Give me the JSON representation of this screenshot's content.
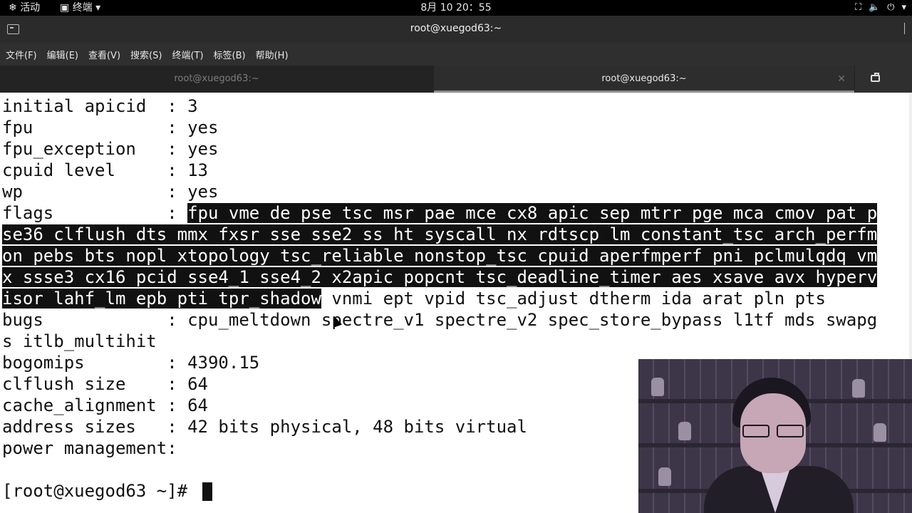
{
  "topbar": {
    "activities": "活动",
    "app_menu": "终端",
    "clock": "8月 10  20：55",
    "tray_icons": [
      "network-icon",
      "volume-icon",
      "power-icon"
    ]
  },
  "window": {
    "title": "root@xuegod63:~"
  },
  "menu": [
    "文件(F)",
    "编辑(E)",
    "查看(V)",
    "搜索(S)",
    "终端(T)",
    "标签(B)",
    "帮助(H)"
  ],
  "tabs": [
    {
      "label": "root@xuegod63:~",
      "active": false
    },
    {
      "label": "root@xuegod63:~",
      "active": true
    }
  ],
  "terminal": {
    "lines": [
      {
        "plain": "initial apicid  : 3",
        "sel": "",
        "after": ""
      },
      {
        "plain": "fpu             : yes",
        "sel": "",
        "after": ""
      },
      {
        "plain": "fpu_exception   : yes",
        "sel": "",
        "after": ""
      },
      {
        "plain": "cpuid level     : 13",
        "sel": "",
        "after": ""
      },
      {
        "plain": "wp              : yes",
        "sel": "",
        "after": ""
      },
      {
        "plain": "flags           : ",
        "sel": "fpu vme de pse tsc msr pae mce cx8 apic sep mtrr pge mca cmov pat p",
        "after": ""
      },
      {
        "plain": "",
        "sel": "se36 clflush dts mmx fxsr sse sse2 ss ht syscall nx rdtscp lm constant_tsc arch_perfm",
        "after": ""
      },
      {
        "plain": "",
        "sel": "on pebs bts nopl xtopology tsc_reliable nonstop_tsc cpuid aperfmperf pni pclmulqdq vm",
        "after": ""
      },
      {
        "plain": "",
        "sel": "x ssse3 cx16 pcid sse4_1 sse4_2 x2apic popcnt tsc_deadline_timer aes xsave avx hyperv",
        "after": ""
      },
      {
        "plain": "",
        "sel": "isor lahf_lm epb pti tpr_shadow",
        "after": " vnmi ept vpid tsc_adjust dtherm ida arat pln pts"
      },
      {
        "plain": "bugs            : cpu_meltdown spectre_v1 spectre_v2 spec_store_bypass l1tf mds swapg",
        "sel": "",
        "after": ""
      },
      {
        "plain": "s itlb_multihit",
        "sel": "",
        "after": ""
      },
      {
        "plain": "bogomips        : 4390.15",
        "sel": "",
        "after": ""
      },
      {
        "plain": "clflush size    : 64",
        "sel": "",
        "after": ""
      },
      {
        "plain": "cache_alignment : 64",
        "sel": "",
        "after": ""
      },
      {
        "plain": "address sizes   : 42 bits physical, 48 bits virtual",
        "sel": "",
        "after": ""
      },
      {
        "plain": "power management:",
        "sel": "",
        "after": ""
      },
      {
        "plain": "",
        "sel": "",
        "after": ""
      },
      {
        "plain": "[root@xuegod63 ~]# ",
        "sel": "",
        "after": ""
      }
    ]
  },
  "colors": {
    "terminal_bg": "#ffffff",
    "terminal_fg": "#111111",
    "selection_bg": "#111111",
    "selection_fg": "#ffffff",
    "chrome_dark": "#2b2b2b"
  }
}
